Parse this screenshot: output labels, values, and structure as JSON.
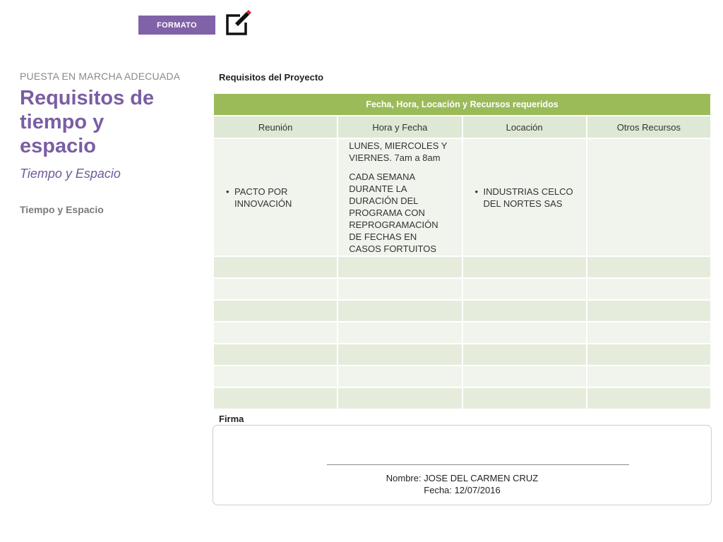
{
  "header": {
    "badge_label": "FORMATO",
    "edit_icon": "edit-checkbox-icon"
  },
  "left": {
    "subtitle": "PUESTA EN MARCHA ADECUADA",
    "title_line1": "Requisitos de",
    "title_line2": "tiempo y",
    "title_line3": "espacio",
    "italic_sub": "Tiempo y Espacio",
    "small_sub": "Tiempo y Espacio"
  },
  "requisitos": {
    "label": "Requisitos del Proyecto",
    "table_caption": "Fecha, Hora, Locación y Recursos requeridos",
    "columns": [
      "Reunión",
      "Hora y Fecha",
      "Locación",
      "Otros Recursos"
    ],
    "row1": {
      "reunion": "PACTO POR INNOVACIÓN",
      "hora_p1": "LUNES, MIERCOLES Y VIERNES. 7am  a  8am",
      "hora_p2": "CADA SEMANA DURANTE LA DURACIÓN DEL PROGRAMA CON REPROGRAMACIÓN DE FECHAS EN CASOS FORTUITOS",
      "locacion": "INDUSTRIAS CELCO DEL NORTES SAS",
      "otros": ""
    }
  },
  "firma": {
    "label": "Firma",
    "nombre": "Nombre:  JOSE DEL CARMEN CRUZ",
    "fecha": "Fecha: 12/07/2016"
  },
  "colors": {
    "accent_purple": "#8062a8",
    "title_purple": "#7a5ea3",
    "table_green": "#9bbb59"
  }
}
